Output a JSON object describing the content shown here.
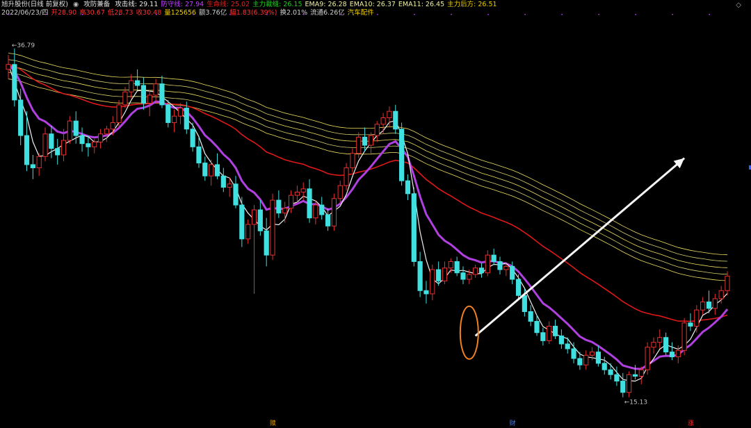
{
  "header": {
    "title": "旭升股份(日线 前复权)",
    "indicator_icon": "circle-icon",
    "indicator_name": "攻防兼备",
    "lines": [
      {
        "label": "攻击线:",
        "value": "29.11",
        "color": "#e8e8e8"
      },
      {
        "label": "防守线:",
        "value": "27.94",
        "color": "#c040ff"
      },
      {
        "label": "生命线:",
        "value": "25.02",
        "color": "#e02020"
      },
      {
        "label": "主力裁缝:",
        "value": "26.15",
        "color": "#20d020"
      },
      {
        "label": "EMA9:",
        "value": "26.28",
        "color": "#f0f0a0"
      },
      {
        "label": "EMA10:",
        "value": "26.37",
        "color": "#f0f0a0"
      },
      {
        "label": "EMA11:",
        "value": "26.45",
        "color": "#f0f0a0"
      },
      {
        "label": "主力后方:",
        "value": "26.51",
        "color": "#f0d000"
      }
    ],
    "row2": [
      {
        "text": "2022/06/23/四",
        "color": "#d0d0d0"
      },
      {
        "text": "开28.90",
        "color": "#ff3030"
      },
      {
        "text": "高30.67",
        "color": "#ff3030"
      },
      {
        "text": "低28.73",
        "color": "#ff3030"
      },
      {
        "text": "收30.48",
        "color": "#ff3030"
      },
      {
        "text": "量125656",
        "color": "#f0d000"
      },
      {
        "text": "额3.76亿",
        "color": "#d0d0d0"
      },
      {
        "text": "幅1.83(6.39%)",
        "color": "#ff3030"
      },
      {
        "text": "换2.01%",
        "color": "#d0d0d0"
      },
      {
        "text": "流通6.26亿",
        "color": "#d0d0d0"
      },
      {
        "text": "汽车配件",
        "color": "#f0d000"
      }
    ],
    "corner_icon": "diamond-icon"
  },
  "chart_data": {
    "type": "candlestick",
    "price_high_label": "36.79",
    "price_low_label": "15.13",
    "ylim": [
      14.5,
      38.5
    ],
    "bottom_markers": [
      {
        "index": 77,
        "label": "赎",
        "color": "#f0a000"
      },
      {
        "index": 146,
        "label": "财",
        "color": "#4080ff"
      },
      {
        "index": 198,
        "label": "涨",
        "color": "#ff3030"
      }
    ],
    "annotations": [
      "arrow-up-right",
      "orange-ellipse"
    ],
    "candles_ohlc": [
      [
        35.5,
        36.4,
        34.9,
        35.8
      ],
      [
        35.8,
        36.79,
        33.2,
        33.6
      ],
      [
        33.6,
        34.3,
        30.8,
        31.4
      ],
      [
        31.4,
        32.9,
        29.2,
        29.6
      ],
      [
        29.6,
        30.2,
        28.7,
        29.4
      ],
      [
        29.4,
        30.3,
        28.9,
        30.1
      ],
      [
        30.1,
        31.9,
        29.8,
        31.5
      ],
      [
        31.5,
        32.0,
        30.0,
        30.6
      ],
      [
        30.6,
        31.2,
        29.6,
        30.2
      ],
      [
        30.2,
        31.8,
        29.8,
        31.1
      ],
      [
        31.1,
        32.6,
        30.9,
        32.3
      ],
      [
        32.3,
        32.9,
        30.9,
        31.4
      ],
      [
        31.4,
        31.9,
        30.4,
        30.9
      ],
      [
        30.9,
        31.4,
        30.1,
        30.7
      ],
      [
        30.7,
        31.2,
        30.3,
        31.0
      ],
      [
        31.0,
        31.8,
        30.6,
        31.5
      ],
      [
        31.5,
        32.0,
        31.0,
        31.8
      ],
      [
        31.8,
        32.6,
        31.4,
        32.2
      ],
      [
        32.2,
        33.6,
        31.9,
        33.3
      ],
      [
        33.3,
        34.4,
        33.1,
        34.1
      ],
      [
        34.1,
        35.2,
        33.7,
        34.8
      ],
      [
        34.8,
        35.5,
        34.2,
        34.5
      ],
      [
        34.5,
        35.0,
        33.0,
        33.4
      ],
      [
        33.4,
        34.2,
        32.6,
        33.9
      ],
      [
        33.9,
        34.9,
        33.5,
        34.6
      ],
      [
        34.6,
        35.1,
        33.1,
        33.3
      ],
      [
        33.3,
        33.6,
        31.9,
        32.2
      ],
      [
        32.2,
        33.0,
        31.6,
        32.6
      ],
      [
        32.6,
        33.4,
        32.1,
        33.1
      ],
      [
        33.1,
        33.5,
        31.5,
        31.8
      ],
      [
        31.8,
        32.2,
        30.4,
        30.7
      ],
      [
        30.7,
        31.3,
        29.4,
        29.7
      ],
      [
        29.7,
        30.1,
        28.6,
        28.9
      ],
      [
        28.9,
        29.9,
        28.3,
        29.6
      ],
      [
        29.6,
        30.3,
        28.7,
        28.9
      ],
      [
        28.9,
        29.4,
        27.9,
        28.2
      ],
      [
        28.2,
        28.8,
        27.6,
        28.4
      ],
      [
        28.4,
        28.9,
        26.9,
        27.1
      ],
      [
        27.1,
        27.6,
        24.5,
        25.0
      ],
      [
        25.0,
        26.2,
        24.7,
        25.9
      ],
      [
        25.9,
        27.1,
        21.6,
        26.8
      ],
      [
        26.8,
        27.4,
        25.2,
        25.5
      ],
      [
        25.5,
        26.3,
        23.3,
        24.0
      ],
      [
        24.0,
        27.8,
        23.7,
        27.4
      ],
      [
        27.4,
        28.0,
        26.3,
        26.6
      ],
      [
        26.6,
        27.3,
        26.0,
        26.9
      ],
      [
        26.9,
        28.0,
        26.6,
        27.7
      ],
      [
        27.7,
        28.3,
        27.1,
        27.9
      ],
      [
        27.9,
        28.5,
        27.4,
        28.1
      ],
      [
        28.1,
        28.7,
        26.0,
        26.3
      ],
      [
        26.3,
        27.4,
        25.9,
        27.1
      ],
      [
        27.1,
        27.6,
        26.2,
        26.5
      ],
      [
        26.5,
        26.9,
        25.5,
        25.8
      ],
      [
        25.8,
        27.8,
        25.5,
        27.5
      ],
      [
        27.5,
        28.6,
        27.2,
        28.3
      ],
      [
        28.3,
        29.7,
        28.0,
        29.4
      ],
      [
        29.4,
        30.6,
        29.1,
        30.3
      ],
      [
        30.3,
        31.6,
        30.0,
        31.3
      ],
      [
        31.3,
        31.9,
        30.4,
        30.8
      ],
      [
        30.8,
        31.6,
        30.2,
        31.4
      ],
      [
        31.4,
        32.3,
        31.0,
        32.1
      ],
      [
        32.1,
        32.8,
        31.5,
        32.5
      ],
      [
        32.5,
        33.2,
        31.9,
        32.9
      ],
      [
        32.9,
        33.3,
        31.5,
        31.8
      ],
      [
        31.8,
        32.2,
        28.3,
        28.6
      ],
      [
        28.6,
        29.0,
        27.4,
        27.8
      ],
      [
        27.8,
        28.2,
        23.3,
        23.6
      ],
      [
        23.6,
        24.2,
        21.4,
        21.8
      ],
      [
        21.8,
        22.4,
        21.0,
        21.6
      ],
      [
        21.6,
        23.4,
        21.2,
        23.1
      ],
      [
        23.1,
        23.6,
        22.1,
        22.4
      ],
      [
        22.4,
        23.6,
        22.2,
        23.2
      ],
      [
        23.2,
        23.8,
        22.9,
        23.6
      ],
      [
        23.6,
        23.9,
        22.7,
        22.9
      ],
      [
        22.9,
        23.3,
        22.2,
        22.5
      ],
      [
        22.5,
        23.1,
        22.2,
        22.8
      ],
      [
        22.8,
        23.4,
        22.6,
        23.2
      ],
      [
        23.2,
        23.5,
        22.6,
        22.9
      ],
      [
        22.9,
        24.3,
        22.7,
        24.0
      ],
      [
        24.0,
        24.4,
        23.4,
        23.6
      ],
      [
        23.6,
        23.9,
        22.8,
        23.1
      ],
      [
        23.1,
        23.5,
        22.7,
        23.3
      ],
      [
        23.3,
        23.6,
        22.2,
        22.5
      ],
      [
        22.5,
        22.8,
        21.2,
        21.5
      ],
      [
        21.5,
        21.9,
        20.2,
        20.5
      ],
      [
        20.5,
        20.9,
        19.6,
        19.9
      ],
      [
        19.9,
        20.3,
        19.0,
        19.2
      ],
      [
        19.2,
        19.5,
        18.4,
        18.7
      ],
      [
        18.7,
        19.9,
        18.5,
        19.6
      ],
      [
        19.6,
        20.0,
        18.8,
        19.0
      ],
      [
        19.0,
        19.4,
        18.2,
        18.5
      ],
      [
        18.5,
        18.9,
        17.9,
        18.2
      ],
      [
        18.2,
        18.6,
        17.3,
        17.6
      ],
      [
        17.6,
        18.0,
        16.9,
        17.2
      ],
      [
        17.2,
        18.1,
        16.9,
        17.8
      ],
      [
        17.8,
        18.3,
        17.5,
        18.0
      ],
      [
        18.0,
        18.4,
        17.1,
        17.3
      ],
      [
        17.3,
        17.7,
        16.6,
        16.9
      ],
      [
        16.9,
        17.3,
        16.3,
        16.6
      ],
      [
        16.6,
        17.1,
        15.9,
        16.2
      ],
      [
        16.2,
        16.7,
        15.2,
        15.5
      ],
      [
        15.5,
        16.8,
        15.2,
        16.6
      ],
      [
        16.6,
        17.2,
        16.3,
        16.5
      ],
      [
        16.5,
        17.1,
        16.0,
        16.9
      ],
      [
        16.9,
        18.6,
        16.6,
        18.3
      ],
      [
        18.3,
        18.9,
        17.9,
        18.6
      ],
      [
        18.6,
        19.4,
        18.2,
        18.9
      ],
      [
        18.9,
        19.2,
        17.8,
        18.0
      ],
      [
        18.0,
        18.6,
        17.5,
        17.7
      ],
      [
        17.7,
        18.4,
        17.3,
        18.1
      ],
      [
        18.1,
        20.1,
        17.8,
        19.8
      ],
      [
        19.8,
        20.4,
        19.3,
        19.6
      ],
      [
        19.6,
        20.9,
        19.2,
        20.6
      ],
      [
        20.6,
        21.4,
        20.3,
        21.1
      ],
      [
        21.1,
        21.8,
        20.4,
        20.7
      ],
      [
        20.7,
        21.6,
        20.3,
        21.3
      ],
      [
        21.3,
        22.1,
        21.0,
        21.8
      ],
      [
        21.8,
        23.0,
        21.5,
        22.7
      ]
    ],
    "ma_lines": [
      "attack-line-white",
      "defense-line-purple",
      "life-line-red",
      "ema-ribbon-yellow"
    ]
  }
}
